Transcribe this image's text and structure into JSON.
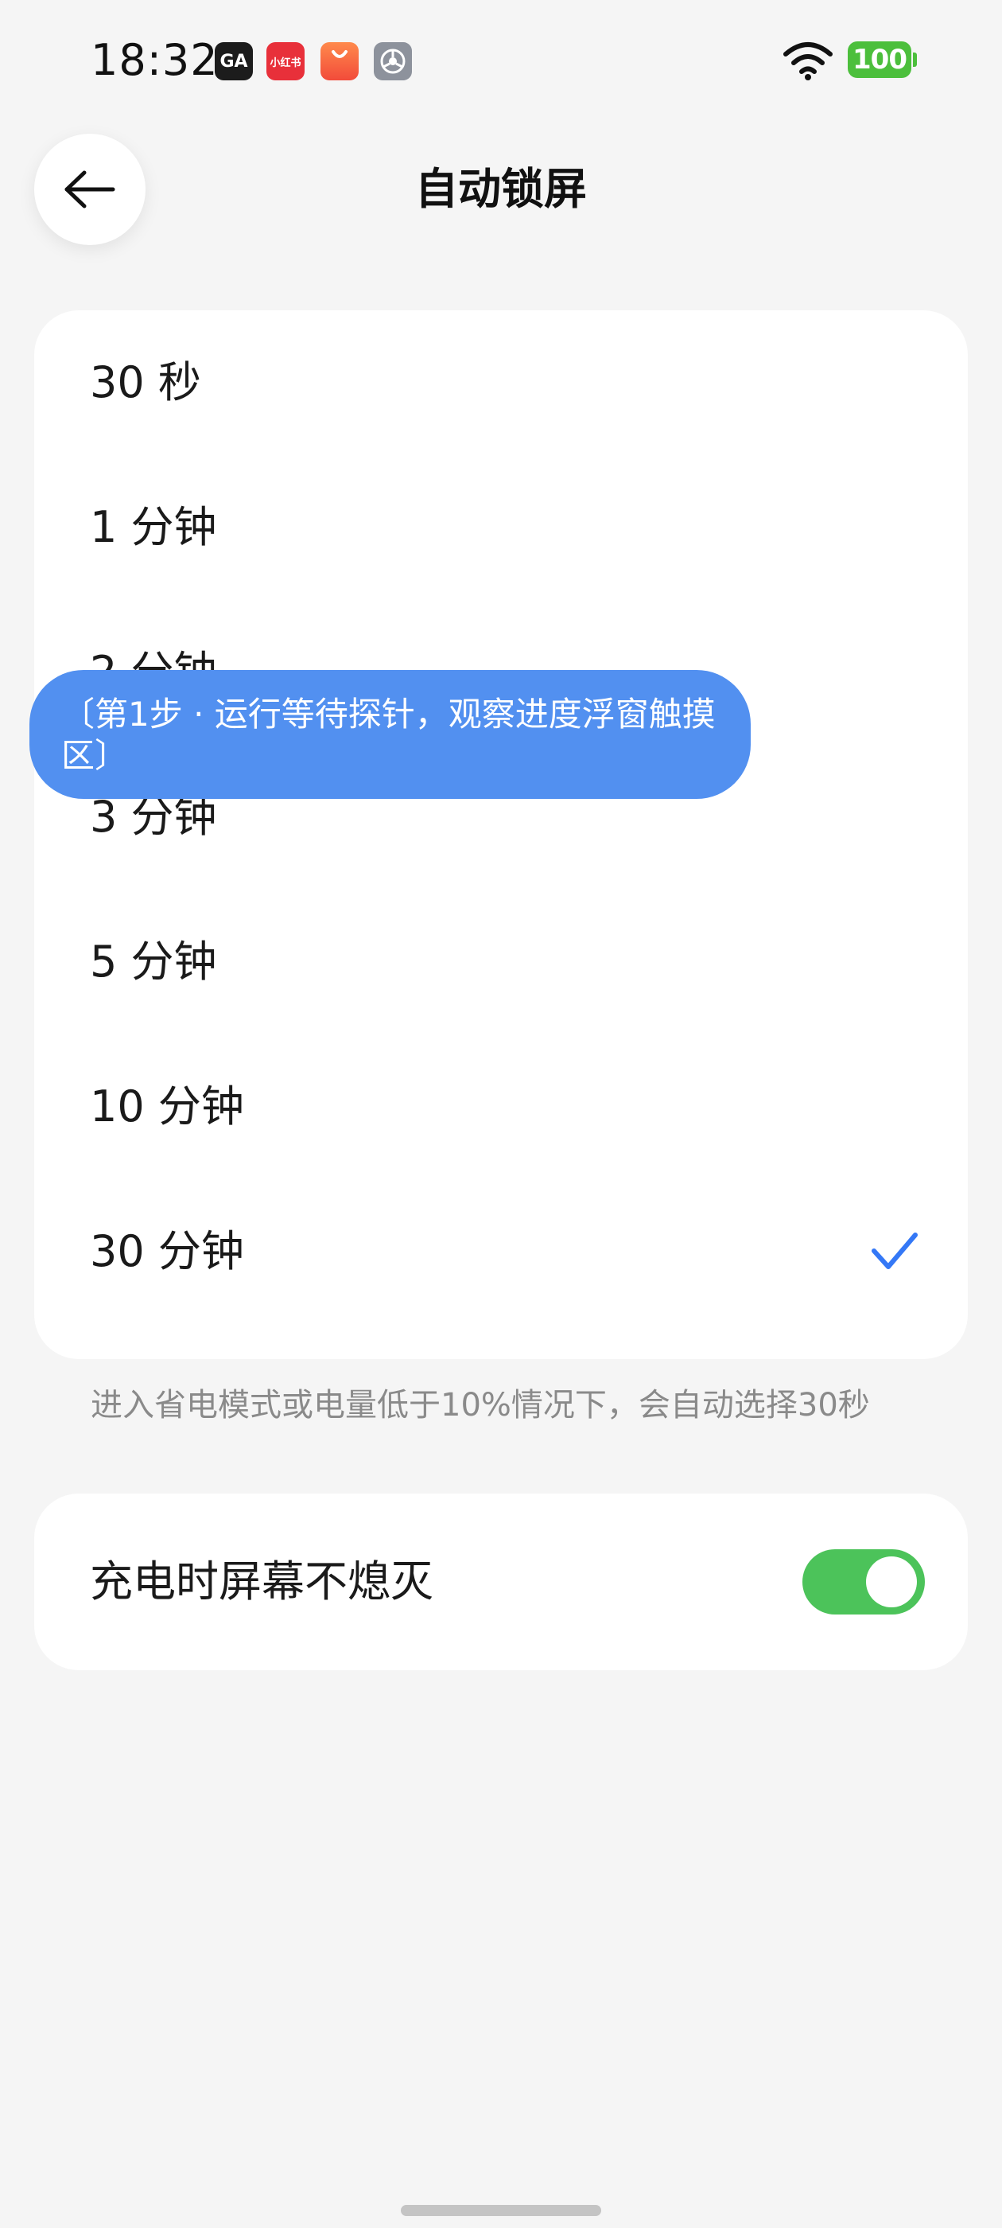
{
  "status_bar": {
    "time": "18:32",
    "apps": [
      {
        "name": "ga-app-icon",
        "label": "GA"
      },
      {
        "name": "xiaohongshu-app-icon",
        "label": "小红书"
      },
      {
        "name": "shop-app-icon"
      },
      {
        "name": "settings-app-icon"
      }
    ],
    "battery": "100",
    "battery_color": "#4cbf3c"
  },
  "header": {
    "title": "自动锁屏"
  },
  "options": [
    {
      "label": "30 秒",
      "selected": false
    },
    {
      "label": "1 分钟",
      "selected": false
    },
    {
      "label": "2 分钟",
      "selected": false
    },
    {
      "label": "3 分钟",
      "selected": false
    },
    {
      "label": "5 分钟",
      "selected": false
    },
    {
      "label": "10 分钟",
      "selected": false
    },
    {
      "label": "30 分钟",
      "selected": true
    }
  ],
  "hint": "进入省电模式或电量低于10%情况下，会自动选择30秒",
  "charging_setting": {
    "label": "充电时屏幕不熄灭",
    "enabled": true,
    "toggle_color": "#4cc35a"
  },
  "overlay": {
    "text": "〔第1步 · 运行等待探针，观察进度浮窗触摸区〕",
    "color": "#5290f0"
  },
  "accent_color": "#3478f6"
}
